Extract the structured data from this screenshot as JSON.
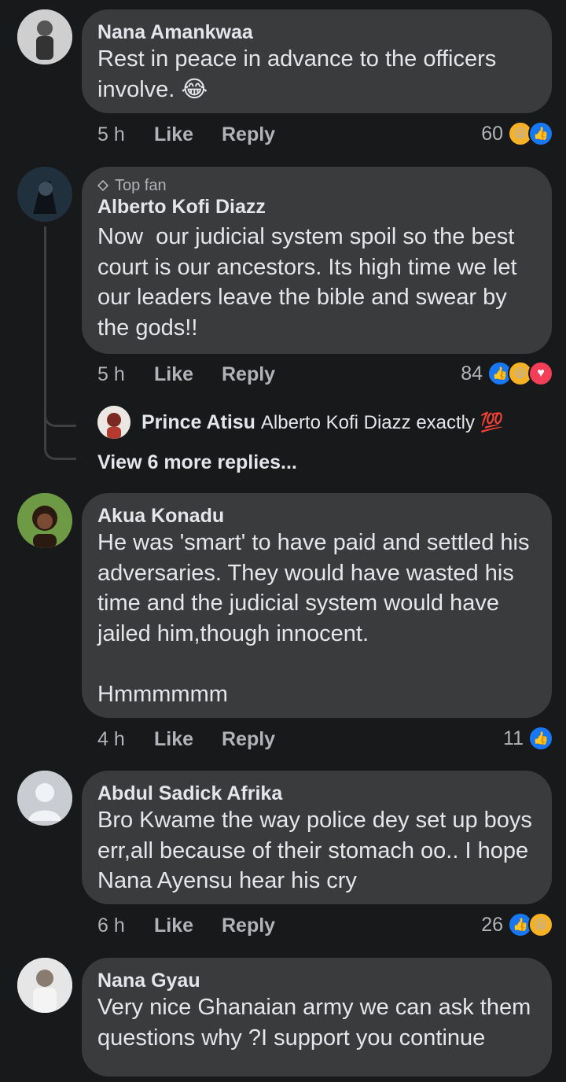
{
  "comments": [
    {
      "name": "Nana Amankwaa",
      "text": "Rest in peace in advance to the officers involve. 😂",
      "time": "5 h",
      "like": "Like",
      "reply": "Reply",
      "reaction_count": "60",
      "reactions": [
        "haha",
        "like"
      ]
    },
    {
      "badge": "Top fan",
      "name": "Alberto Kofi Diazz",
      "text": "Now  our judicial system spoil so the best court is our ancestors. Its high time we let our leaders leave the bible and swear by the gods!!",
      "time": "5 h",
      "like": "Like",
      "reply": "Reply",
      "reaction_count": "84",
      "reactions": [
        "like",
        "haha",
        "love"
      ],
      "reply_preview": {
        "name": "Prince Atisu",
        "text": "Alberto Kofi Diazz exactly 💯"
      },
      "more_replies": "View 6 more replies..."
    },
    {
      "name": "Akua Konadu",
      "text": "He was 'smart' to have paid and settled his adversaries. They would have wasted his time and the judicial system would have jailed him,though innocent.\n\nHmmmmmm",
      "time": "4 h",
      "like": "Like",
      "reply": "Reply",
      "reaction_count": "11",
      "reactions": [
        "like"
      ]
    },
    {
      "name": "Abdul Sadick Afrika",
      "text": "Bro Kwame the way police dey set up boys err,all because of their stomach oo.. I hope Nana Ayensu hear his cry",
      "time": "6 h",
      "like": "Like",
      "reply": "Reply",
      "reaction_count": "26",
      "reactions": [
        "like",
        "haha"
      ]
    },
    {
      "name": "Nana Gyau",
      "text": "Very nice Ghanaian army we can ask them questions why ?I support you continue"
    }
  ],
  "colors": {
    "background": "#18191a",
    "bubble": "#3a3b3c",
    "like_blue": "#1877f2",
    "haha_yellow": "#f7b125",
    "love_red": "#f33e58"
  }
}
